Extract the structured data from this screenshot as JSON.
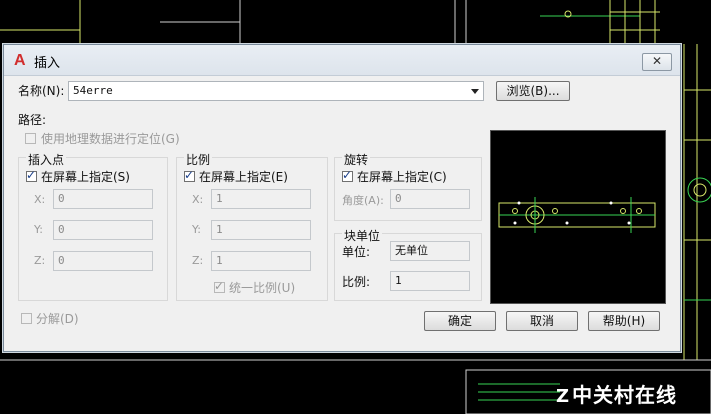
{
  "dialog": {
    "title": "插入",
    "close_glyph": "✕",
    "name_label": "名称(N):",
    "name_value": "54erre",
    "browse_button": "浏览(B)...",
    "path_label": "路径:",
    "geo_checkbox_label": "使用地理数据进行定位(G)",
    "insertion": {
      "title": "插入点",
      "specify_label": "在屏幕上指定(S)",
      "x_label": "X:",
      "x_value": "0",
      "y_label": "Y:",
      "y_value": "0",
      "z_label": "Z:",
      "z_value": "0"
    },
    "scale": {
      "title": "比例",
      "specify_label": "在屏幕上指定(E)",
      "x_label": "X:",
      "x_value": "1",
      "y_label": "Y:",
      "y_value": "1",
      "z_label": "Z:",
      "z_value": "1",
      "uniform_label": "统一比例(U)"
    },
    "rotation": {
      "title": "旋转",
      "specify_label": "在屏幕上指定(C)",
      "angle_label": "角度(A):",
      "angle_value": "0"
    },
    "block_unit": {
      "title": "块单位",
      "unit_label": "单位:",
      "unit_value": "无单位",
      "factor_label": "比例:",
      "factor_value": "1"
    },
    "explode_label": "分解(D)",
    "ok_button": "确定",
    "cancel_button": "取消",
    "help_button": "帮助(H)"
  },
  "watermark": "中关村在线",
  "colors": {
    "cad_line": "#d8e86a",
    "cad_green": "#39d353",
    "dialog_bg": "#f0f0f0",
    "autocad_red": "#d12d2d"
  }
}
